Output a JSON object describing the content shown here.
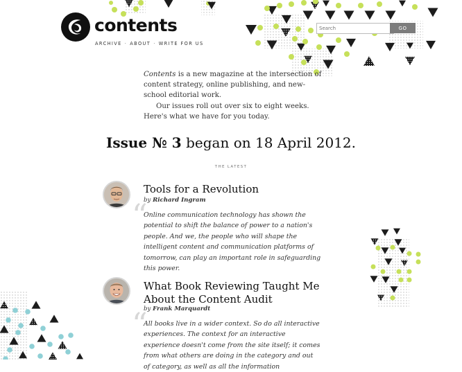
{
  "header": {
    "brand": "contents",
    "nav": [
      {
        "label": "ARCHIVE"
      },
      {
        "label": "ABOUT"
      },
      {
        "label": "WRITE FOR US"
      }
    ],
    "nav_separator": "·",
    "search": {
      "placeholder": "Search",
      "button": "GO"
    }
  },
  "intro": {
    "brand_italic": "Contents",
    "p1_rest": " is a new magazine at the intersection of content strategy, online publishing, and new-school editorial work.",
    "p2": "Our issues roll out over six to eight weeks. Here's what we have for you today."
  },
  "issue": {
    "label": "Issue № 3",
    "rest": " began on 18 April 2012."
  },
  "latest_label": "THE LATEST",
  "articles": [
    {
      "title": "Tools for a Revolution",
      "by": "by",
      "author": "Richard Ingram",
      "excerpt": "Online communication technology has shown the potential to shift the balance of power to a nation's people. And we, the people who will shape the intelligent content and communication platforms of tomorrow, can play an important role in safeguarding this power."
    },
    {
      "title": "What Book Reviewing Taught Me About the Content Audit",
      "by": "by",
      "author": "Frank Marquardt",
      "excerpt": "All books live in a wider context. So do all interactive experiences. The context for an interactive experience doesn't come from the site itself; it comes from what others are doing in the category and out of category, as well as all the information"
    }
  ],
  "quote_glyph": "“",
  "colors": {
    "accent_lime": "#c6e05a",
    "accent_teal": "#8fd0d6",
    "triangle": "#1c1c1c",
    "go_button": "#7c7c7c"
  }
}
